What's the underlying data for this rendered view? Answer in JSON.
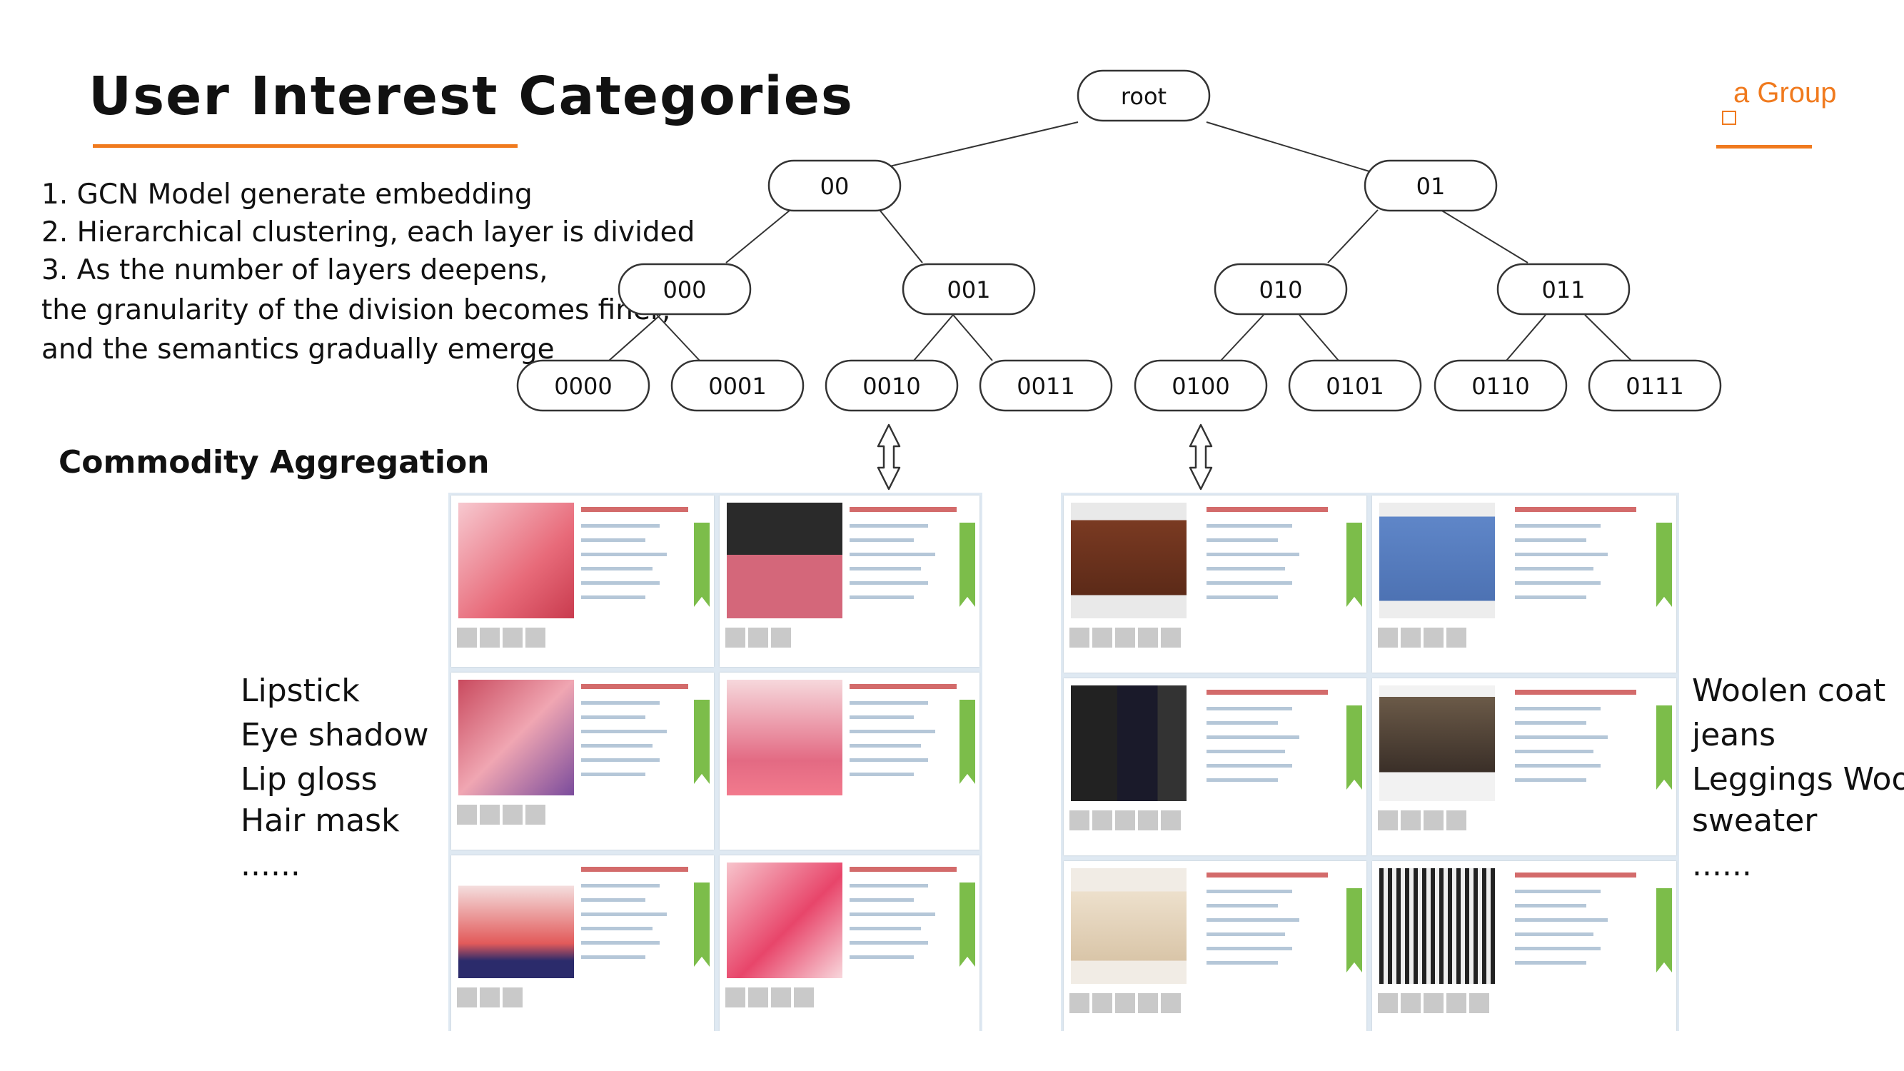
{
  "slide": {
    "title": "User Interest Categories",
    "logo_text": "a Group",
    "accent_color": "#f07a1e"
  },
  "steps": [
    "1. GCN Model generate embedding",
    "2. Hierarchical clustering, each layer is divided",
    "3. As the number of layers deepens,",
    "the granularity of the division becomes finer,",
    "and the semantics gradually emerge"
  ],
  "tree": {
    "root": "root",
    "level1": [
      "00",
      "01"
    ],
    "level2": [
      "000",
      "001",
      "010",
      "011"
    ],
    "level3": [
      "0000",
      "0001",
      "0010",
      "0011",
      "0100",
      "0101",
      "0110",
      "0111"
    ]
  },
  "commodity": {
    "heading": "Commodity Aggregation",
    "left_categories": [
      "Lipstick",
      "Eye shadow",
      "Lip gloss",
      "Hair mask",
      "......"
    ],
    "right_categories": [
      "Woolen coat",
      "jeans",
      "Leggings Wool",
      "sweater",
      "......"
    ],
    "left_panel_icons": [
      "lipstick-product-icon",
      "blush-palette-icon",
      "eyeshadow-palette-icon",
      "lip-gloss-set-icon",
      "hair-mask-icon",
      "lip-tint-icon"
    ],
    "right_panel_icons": [
      "brown-coat-icon",
      "blue-coat-icon",
      "black-jeans-icon",
      "leggings-icon",
      "cream-sweater-icon",
      "striped-pants-icon"
    ]
  }
}
